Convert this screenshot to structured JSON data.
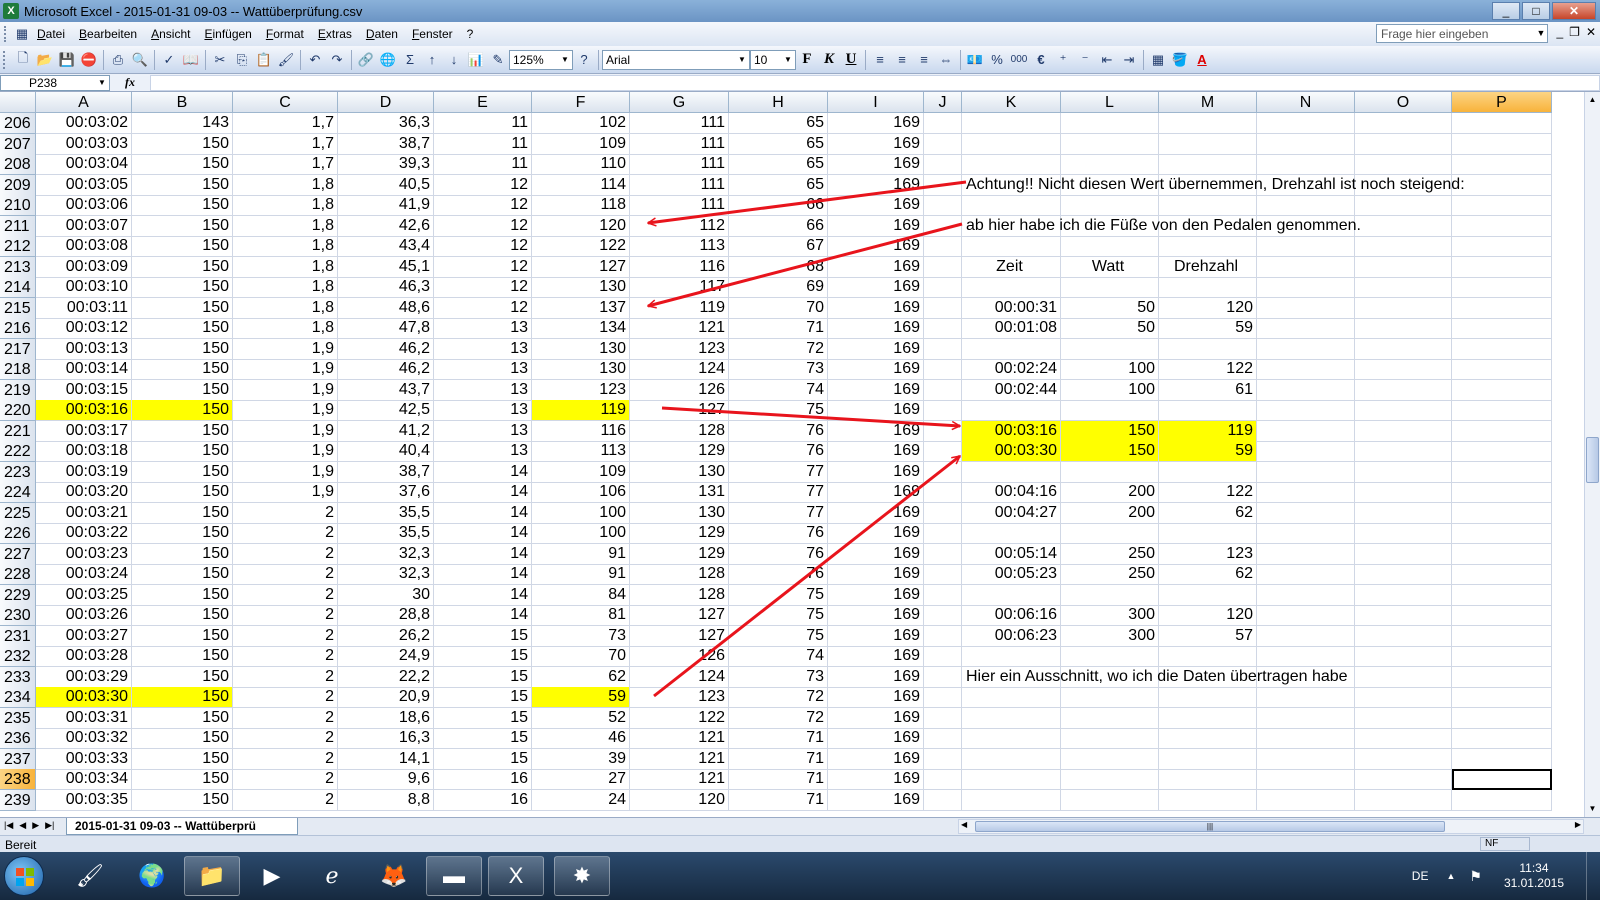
{
  "window": {
    "title": "Microsoft Excel - 2015-01-31 09-03 -- Wattüberprüfung.csv",
    "app_icon": "excel-icon",
    "buttons": [
      "_",
      "□",
      "✕"
    ]
  },
  "menu": {
    "items": [
      "Datei",
      "Bearbeiten",
      "Ansicht",
      "Einfügen",
      "Format",
      "Extras",
      "Daten",
      "Fenster",
      "?"
    ],
    "help_placeholder": "Frage hier eingeben"
  },
  "toolbar": {
    "zoom": "125%",
    "font": "Arial",
    "font_size": "10",
    "bold": "F",
    "italic": "K",
    "underline": "U",
    "percent": "%",
    "thousands": "000",
    "euro": "€",
    "font_color_label": "A"
  },
  "formula": {
    "name_box": "P238",
    "fx": "fx",
    "value": ""
  },
  "columns": [
    "A",
    "B",
    "C",
    "D",
    "E",
    "F",
    "G",
    "H",
    "I",
    "J",
    "K",
    "L",
    "M",
    "N",
    "O",
    "P"
  ],
  "active_column": "P",
  "active_row": "238",
  "rows": [
    {
      "n": "206",
      "v": [
        "00:03:02",
        "143",
        "1,7",
        "36,3",
        "11",
        "102",
        "111",
        "65",
        "169"
      ]
    },
    {
      "n": "207",
      "v": [
        "00:03:03",
        "150",
        "1,7",
        "38,7",
        "11",
        "109",
        "111",
        "65",
        "169"
      ]
    },
    {
      "n": "208",
      "v": [
        "00:03:04",
        "150",
        "1,7",
        "39,3",
        "11",
        "110",
        "111",
        "65",
        "169"
      ]
    },
    {
      "n": "209",
      "v": [
        "00:03:05",
        "150",
        "1,8",
        "40,5",
        "12",
        "114",
        "111",
        "65",
        "169"
      ]
    },
    {
      "n": "210",
      "v": [
        "00:03:06",
        "150",
        "1,8",
        "41,9",
        "12",
        "118",
        "111",
        "66",
        "169"
      ]
    },
    {
      "n": "211",
      "v": [
        "00:03:07",
        "150",
        "1,8",
        "42,6",
        "12",
        "120",
        "112",
        "66",
        "169"
      ]
    },
    {
      "n": "212",
      "v": [
        "00:03:08",
        "150",
        "1,8",
        "43,4",
        "12",
        "122",
        "113",
        "67",
        "169"
      ]
    },
    {
      "n": "213",
      "v": [
        "00:03:09",
        "150",
        "1,8",
        "45,1",
        "12",
        "127",
        "116",
        "68",
        "169"
      ]
    },
    {
      "n": "214",
      "v": [
        "00:03:10",
        "150",
        "1,8",
        "46,3",
        "12",
        "130",
        "117",
        "69",
        "169"
      ]
    },
    {
      "n": "215",
      "v": [
        "00:03:11",
        "150",
        "1,8",
        "48,6",
        "12",
        "137",
        "119",
        "70",
        "169"
      ]
    },
    {
      "n": "216",
      "v": [
        "00:03:12",
        "150",
        "1,8",
        "47,8",
        "13",
        "134",
        "121",
        "71",
        "169"
      ]
    },
    {
      "n": "217",
      "v": [
        "00:03:13",
        "150",
        "1,9",
        "46,2",
        "13",
        "130",
        "123",
        "72",
        "169"
      ]
    },
    {
      "n": "218",
      "v": [
        "00:03:14",
        "150",
        "1,9",
        "46,2",
        "13",
        "130",
        "124",
        "73",
        "169"
      ]
    },
    {
      "n": "219",
      "v": [
        "00:03:15",
        "150",
        "1,9",
        "43,7",
        "13",
        "123",
        "126",
        "74",
        "169"
      ]
    },
    {
      "n": "220",
      "v": [
        "00:03:16",
        "150",
        "1,9",
        "42,5",
        "13",
        "119",
        "127",
        "75",
        "169"
      ],
      "hl": true
    },
    {
      "n": "221",
      "v": [
        "00:03:17",
        "150",
        "1,9",
        "41,2",
        "13",
        "116",
        "128",
        "76",
        "169"
      ]
    },
    {
      "n": "222",
      "v": [
        "00:03:18",
        "150",
        "1,9",
        "40,4",
        "13",
        "113",
        "129",
        "76",
        "169"
      ]
    },
    {
      "n": "223",
      "v": [
        "00:03:19",
        "150",
        "1,9",
        "38,7",
        "14",
        "109",
        "130",
        "77",
        "169"
      ]
    },
    {
      "n": "224",
      "v": [
        "00:03:20",
        "150",
        "1,9",
        "37,6",
        "14",
        "106",
        "131",
        "77",
        "169"
      ]
    },
    {
      "n": "225",
      "v": [
        "00:03:21",
        "150",
        "2",
        "35,5",
        "14",
        "100",
        "130",
        "77",
        "169"
      ]
    },
    {
      "n": "226",
      "v": [
        "00:03:22",
        "150",
        "2",
        "35,5",
        "14",
        "100",
        "129",
        "76",
        "169"
      ]
    },
    {
      "n": "227",
      "v": [
        "00:03:23",
        "150",
        "2",
        "32,3",
        "14",
        "91",
        "129",
        "76",
        "169"
      ]
    },
    {
      "n": "228",
      "v": [
        "00:03:24",
        "150",
        "2",
        "32,3",
        "14",
        "91",
        "128",
        "76",
        "169"
      ]
    },
    {
      "n": "229",
      "v": [
        "00:03:25",
        "150",
        "2",
        "30",
        "14",
        "84",
        "128",
        "75",
        "169"
      ]
    },
    {
      "n": "230",
      "v": [
        "00:03:26",
        "150",
        "2",
        "28,8",
        "14",
        "81",
        "127",
        "75",
        "169"
      ]
    },
    {
      "n": "231",
      "v": [
        "00:03:27",
        "150",
        "2",
        "26,2",
        "15",
        "73",
        "127",
        "75",
        "169"
      ]
    },
    {
      "n": "232",
      "v": [
        "00:03:28",
        "150",
        "2",
        "24,9",
        "15",
        "70",
        "126",
        "74",
        "169"
      ]
    },
    {
      "n": "233",
      "v": [
        "00:03:29",
        "150",
        "2",
        "22,2",
        "15",
        "62",
        "124",
        "73",
        "169"
      ]
    },
    {
      "n": "234",
      "v": [
        "00:03:30",
        "150",
        "2",
        "20,9",
        "15",
        "59",
        "123",
        "72",
        "169"
      ],
      "hl": true
    },
    {
      "n": "235",
      "v": [
        "00:03:31",
        "150",
        "2",
        "18,6",
        "15",
        "52",
        "122",
        "72",
        "169"
      ]
    },
    {
      "n": "236",
      "v": [
        "00:03:32",
        "150",
        "2",
        "16,3",
        "15",
        "46",
        "121",
        "71",
        "169"
      ]
    },
    {
      "n": "237",
      "v": [
        "00:03:33",
        "150",
        "2",
        "14,1",
        "15",
        "39",
        "121",
        "71",
        "169"
      ]
    },
    {
      "n": "238",
      "v": [
        "00:03:34",
        "150",
        "2",
        "9,6",
        "16",
        "27",
        "121",
        "71",
        "169"
      ]
    },
    {
      "n": "239",
      "v": [
        "00:03:35",
        "150",
        "2",
        "8,8",
        "16",
        "24",
        "120",
        "71",
        "169"
      ]
    }
  ],
  "notes": {
    "warning": "Achtung!! Nicht diesen Wert übernemmen, Drehzahl ist noch steigend:",
    "feet_off": "ab hier habe ich die Füße von den Pedalen genommen.",
    "excerpt": "Hier ein Ausschnitt, wo ich die Daten übertragen habe"
  },
  "summary": {
    "headers": [
      "Zeit",
      "Watt",
      "Drehzahl"
    ],
    "rows": [
      {
        "row": "215",
        "v": [
          "00:00:31",
          "50",
          "120"
        ]
      },
      {
        "row": "216",
        "v": [
          "00:01:08",
          "50",
          "59"
        ]
      },
      {
        "row": "218",
        "v": [
          "00:02:24",
          "100",
          "122"
        ]
      },
      {
        "row": "219",
        "v": [
          "00:02:44",
          "100",
          "61"
        ]
      },
      {
        "row": "221",
        "v": [
          "00:03:16",
          "150",
          "119"
        ],
        "hl": true
      },
      {
        "row": "222",
        "v": [
          "00:03:30",
          "150",
          "59"
        ],
        "hl": true
      },
      {
        "row": "224",
        "v": [
          "00:04:16",
          "200",
          "122"
        ]
      },
      {
        "row": "225",
        "v": [
          "00:04:27",
          "200",
          "62"
        ]
      },
      {
        "row": "227",
        "v": [
          "00:05:14",
          "250",
          "123"
        ]
      },
      {
        "row": "228",
        "v": [
          "00:05:23",
          "250",
          "62"
        ]
      },
      {
        "row": "230",
        "v": [
          "00:06:16",
          "300",
          "120"
        ]
      },
      {
        "row": "231",
        "v": [
          "00:06:23",
          "300",
          "57"
        ]
      }
    ]
  },
  "highlight_color": "#ffff00",
  "arrow_color": "#e8141c",
  "sheet_tab": "2015-01-31 09-03 -- Wattüberprü",
  "status": {
    "text": "Bereit",
    "nf": "NF"
  },
  "taskbar": {
    "lang": "DE",
    "time": "11:34",
    "date": "31.01.2015"
  }
}
